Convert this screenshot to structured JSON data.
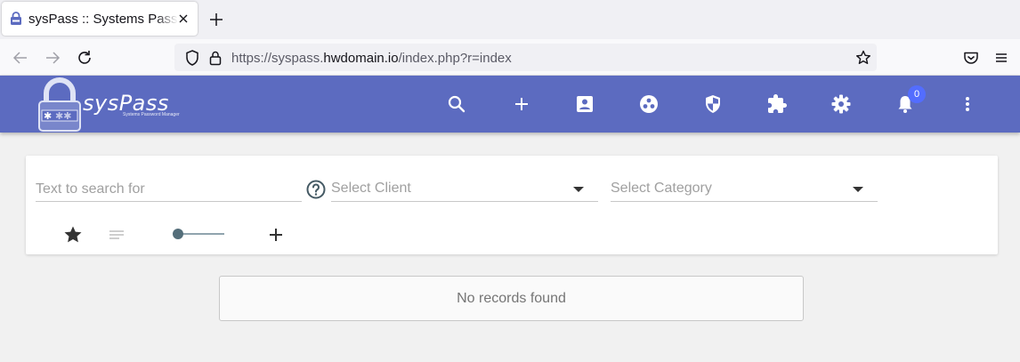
{
  "browser": {
    "tab_title": "sysPass :: Systems Password Manager",
    "url_prefix": "https://syspass.",
    "url_host": "hwdomain.io",
    "url_path": "/index.php?r=index"
  },
  "app": {
    "logo_name": "sysPass",
    "logo_subtitle": "Systems Password Manager",
    "header_icons": [
      "search-icon",
      "add-icon",
      "account-box-icon",
      "group-icon",
      "security-icon",
      "extension-icon",
      "settings-icon",
      "notifications-icon",
      "more-vert-icon"
    ],
    "notification_count": "0",
    "colors": {
      "header": "#5c6bc0",
      "badge": "#536dfe",
      "slider": "#546e7a"
    }
  },
  "search": {
    "placeholder": "Text to search for",
    "client_select": "Select Client",
    "category_select": "Select Category"
  },
  "results": {
    "message": "No records found"
  }
}
